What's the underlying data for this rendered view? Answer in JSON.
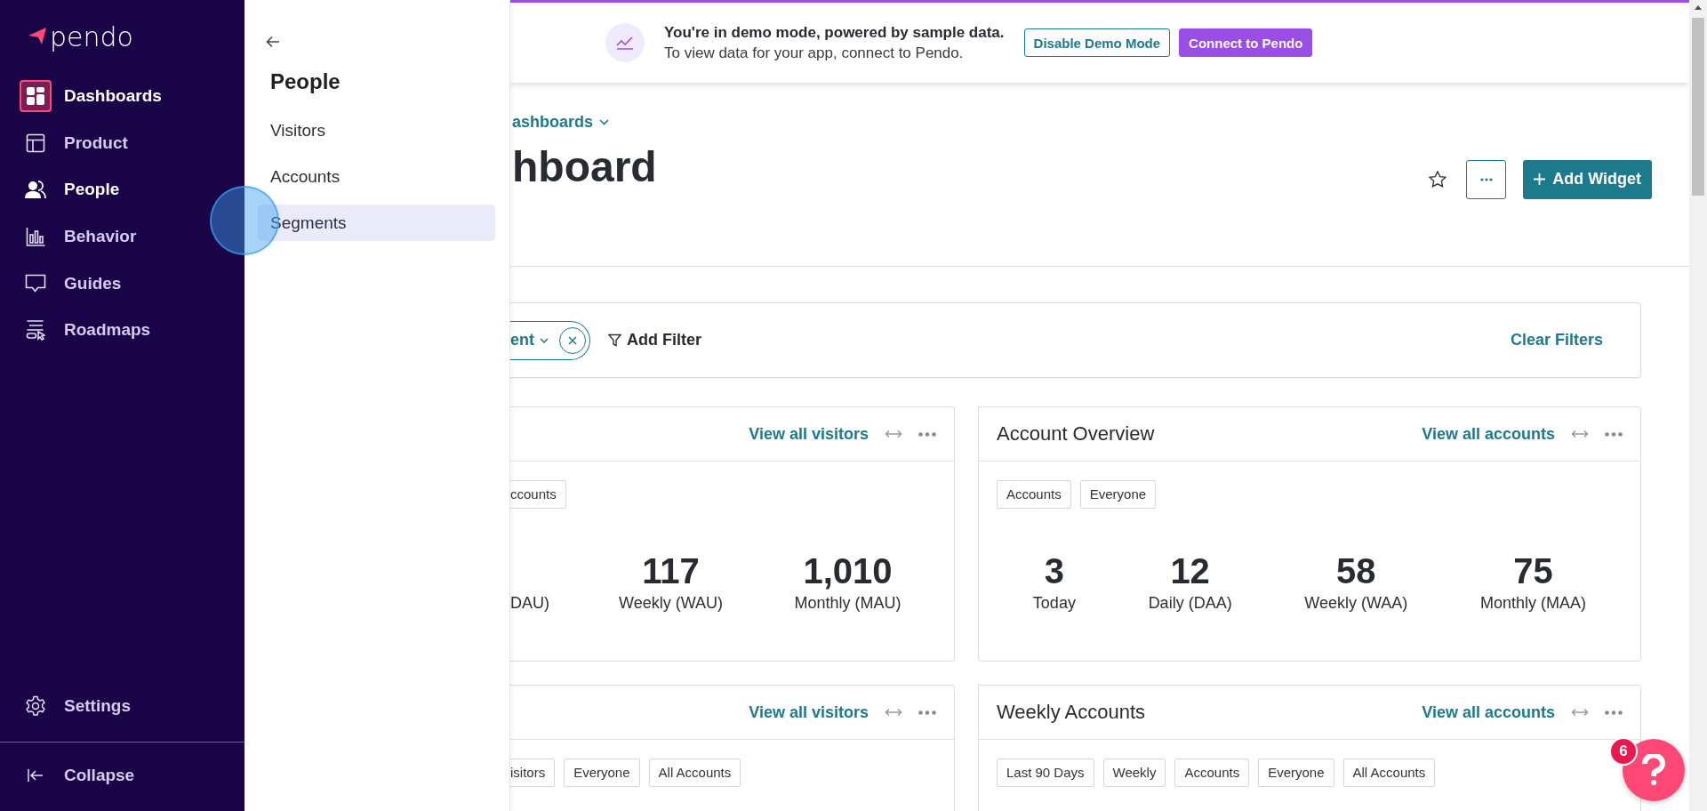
{
  "nav": {
    "logo": "pendo",
    "items": [
      {
        "label": "Dashboards",
        "selected": true,
        "open": false
      },
      {
        "label": "Product",
        "selected": false,
        "open": false
      },
      {
        "label": "People",
        "selected": false,
        "open": true
      },
      {
        "label": "Behavior",
        "selected": false,
        "open": false
      },
      {
        "label": "Guides",
        "selected": false,
        "open": false
      },
      {
        "label": "Roadmaps",
        "selected": false,
        "open": false
      }
    ],
    "settings": "Settings",
    "collapse": "Collapse"
  },
  "flyout": {
    "title": "People",
    "items": [
      {
        "label": "Visitors",
        "selected": false
      },
      {
        "label": "Accounts",
        "selected": false
      },
      {
        "label": "Segments",
        "selected": true
      }
    ]
  },
  "banner": {
    "headline": "You're in demo mode, powered by sample data.",
    "text": "To view data for your app, connect to Pendo.",
    "buttons": [
      {
        "label": "Disable Demo Mode",
        "kind": "outline"
      },
      {
        "label": "Connect to Pendo",
        "kind": "primary"
      }
    ]
  },
  "page": {
    "breadcrumb": "ashboards",
    "title": "hboard",
    "add_widget": "Add Widget"
  },
  "filters": {
    "chip": "ent",
    "add_filter": "Add Filter",
    "clear": "Clear Filters"
  },
  "widgets": [
    {
      "link": "View all visitors",
      "tags": [
        "ccounts"
      ],
      "stats": [
        {
          "label": "DAU)"
        },
        {
          "value": "117",
          "label": "Weekly (WAU)"
        },
        {
          "value": "1,010",
          "label": "Monthly (MAU)"
        }
      ]
    },
    {
      "title": "Account Overview",
      "link": "View all accounts",
      "tags": [
        "Accounts",
        "Everyone"
      ],
      "stats": [
        {
          "value": "3",
          "label": "Today"
        },
        {
          "value": "12",
          "label": "Daily (DAA)"
        },
        {
          "value": "58",
          "label": "Weekly (WAA)"
        },
        {
          "value": "75",
          "label": "Monthly (MAA)"
        }
      ]
    },
    {
      "link": "View all visitors",
      "tags": [
        "isitors",
        "Everyone",
        "All Accounts"
      ]
    },
    {
      "title": "Weekly Accounts",
      "link": "View all accounts",
      "tags": [
        "Last 90 Days",
        "Weekly",
        "Accounts",
        "Everyone",
        "All Accounts"
      ]
    }
  ],
  "help": {
    "badge": "6"
  }
}
